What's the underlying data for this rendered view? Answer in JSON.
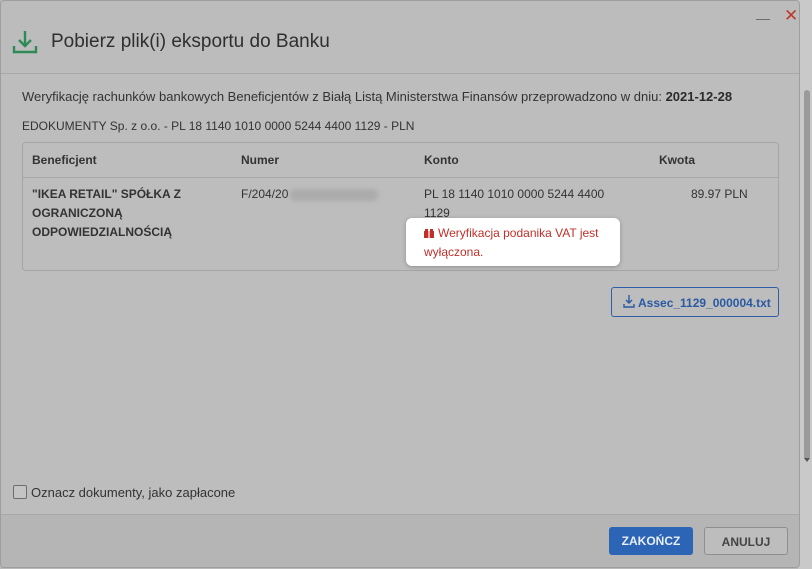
{
  "dialog": {
    "title": "Pobierz plik(i) eksportu do Banku",
    "minimize_glyph": "—",
    "close_glyph": "✕"
  },
  "verification": {
    "text": "Weryfikację rachunków bankowych Beneficjentów z Białą Listą Ministerstwa Finansów przeprowadzono w dniu:",
    "date": "2021-12-28"
  },
  "company_line": "EDOKUMENTY Sp. z o.o. - PL 18 1140 1010 0000 5244 4400 1129 - PLN",
  "table": {
    "headers": {
      "beneficiary": "Beneficjent",
      "number": "Numer",
      "account": "Konto",
      "amount": "Kwota"
    },
    "rows": [
      {
        "beneficiary_line1": "\"IKEA RETAIL\" SPÓŁKA Z",
        "beneficiary_line2": "OGRANICZONĄ",
        "beneficiary_line3": "ODPOWIEDZIALNOŚCIĄ",
        "number": "F/204/20",
        "account_line1": "PL 18 1140 1010 0000 5244 4400",
        "account_line2": "1129",
        "amount": "89.97 PLN"
      }
    ]
  },
  "vat_warning": {
    "line1": "Weryfikacja podanika VAT jest",
    "line2": "wyłączona.",
    "icon": "gift-icon",
    "color": "#c0302a"
  },
  "file_button": {
    "label": "Assec_1129_000004.txt",
    "icon": "download-icon"
  },
  "mark_paid": {
    "label": "Oznacz dokumenty, jako zapłacone",
    "checked": false
  },
  "footer": {
    "finish_label": "ZAKOŃCZ",
    "cancel_label": "ANULUJ"
  },
  "colors": {
    "accent": "#2c65b5",
    "title_icon": "#2e8b57",
    "close": "#c0392b"
  }
}
